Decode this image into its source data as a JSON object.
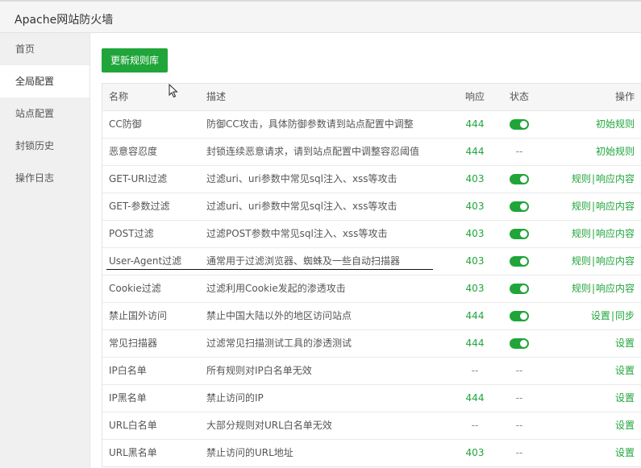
{
  "window": {
    "title": "Apache网站防火墙"
  },
  "sidebar": {
    "items": [
      {
        "label": "首页"
      },
      {
        "label": "全局配置"
      },
      {
        "label": "站点配置"
      },
      {
        "label": "封锁历史"
      },
      {
        "label": "操作日志"
      }
    ],
    "active_index": 1
  },
  "toolbar": {
    "update_label": "更新规则库"
  },
  "table": {
    "headers": {
      "name": "名称",
      "desc": "描述",
      "code": "响应",
      "status": "状态",
      "ops": "操作"
    },
    "rows": [
      {
        "name": "CC防御",
        "desc": "防御CC攻击，具体防御参数请到站点配置中调整",
        "code": "444",
        "status": "on",
        "ops": [
          "初始规则"
        ]
      },
      {
        "name": "恶意容忍度",
        "desc": "封锁连续恶意请求，请到站点配置中调整容忍阈值",
        "code": "444",
        "status": "--",
        "ops": [
          "初始规则"
        ]
      },
      {
        "name": "GET-URI过滤",
        "desc": "过滤uri、uri参数中常见sql注入、xss等攻击",
        "code": "403",
        "status": "on",
        "ops": [
          "规则",
          "响应内容"
        ]
      },
      {
        "name": "GET-参数过滤",
        "desc": "过滤uri、uri参数中常见sql注入、xss等攻击",
        "code": "403",
        "status": "on",
        "ops": [
          "规则",
          "响应内容"
        ]
      },
      {
        "name": "POST过滤",
        "desc": "过滤POST参数中常见sql注入、xss等攻击",
        "code": "403",
        "status": "on",
        "ops": [
          "规则",
          "响应内容"
        ]
      },
      {
        "name": "User-Agent过滤",
        "desc": "通常用于过滤浏览器、蜘蛛及一些自动扫描器",
        "code": "403",
        "status": "on",
        "ops": [
          "规则",
          "响应内容"
        ]
      },
      {
        "name": "Cookie过滤",
        "desc": "过滤利用Cookie发起的渗透攻击",
        "code": "403",
        "status": "on",
        "ops": [
          "规则",
          "响应内容"
        ]
      },
      {
        "name": "禁止国外访问",
        "desc": "禁止中国大陆以外的地区访问站点",
        "code": "444",
        "status": "on",
        "ops": [
          "设置",
          "同步"
        ]
      },
      {
        "name": "常见扫描器",
        "desc": "过滤常见扫描测试工具的渗透测试",
        "code": "444",
        "status": "on",
        "ops": [
          "设置"
        ]
      },
      {
        "name": "IP白名单",
        "desc": "所有规则对IP白名单无效",
        "code": "--",
        "status": "--",
        "ops": [
          "设置"
        ]
      },
      {
        "name": "IP黑名单",
        "desc": "禁止访问的IP",
        "code": "444",
        "status": "--",
        "ops": [
          "设置"
        ]
      },
      {
        "name": "URL白名单",
        "desc": "大部分规则对URL白名单无效",
        "code": "--",
        "status": "--",
        "ops": [
          "设置"
        ]
      },
      {
        "name": "URL黑名单",
        "desc": "禁止访问的URL地址",
        "code": "403",
        "status": "--",
        "ops": [
          "设置"
        ]
      }
    ]
  },
  "colors": {
    "accent": "#20a53a",
    "sidebar_bg": "#f0f0f0",
    "header_bg": "#f6f6f6"
  },
  "icons": {
    "cursor": "mouse-pointer-icon",
    "toggle": "toggle-on-icon"
  }
}
